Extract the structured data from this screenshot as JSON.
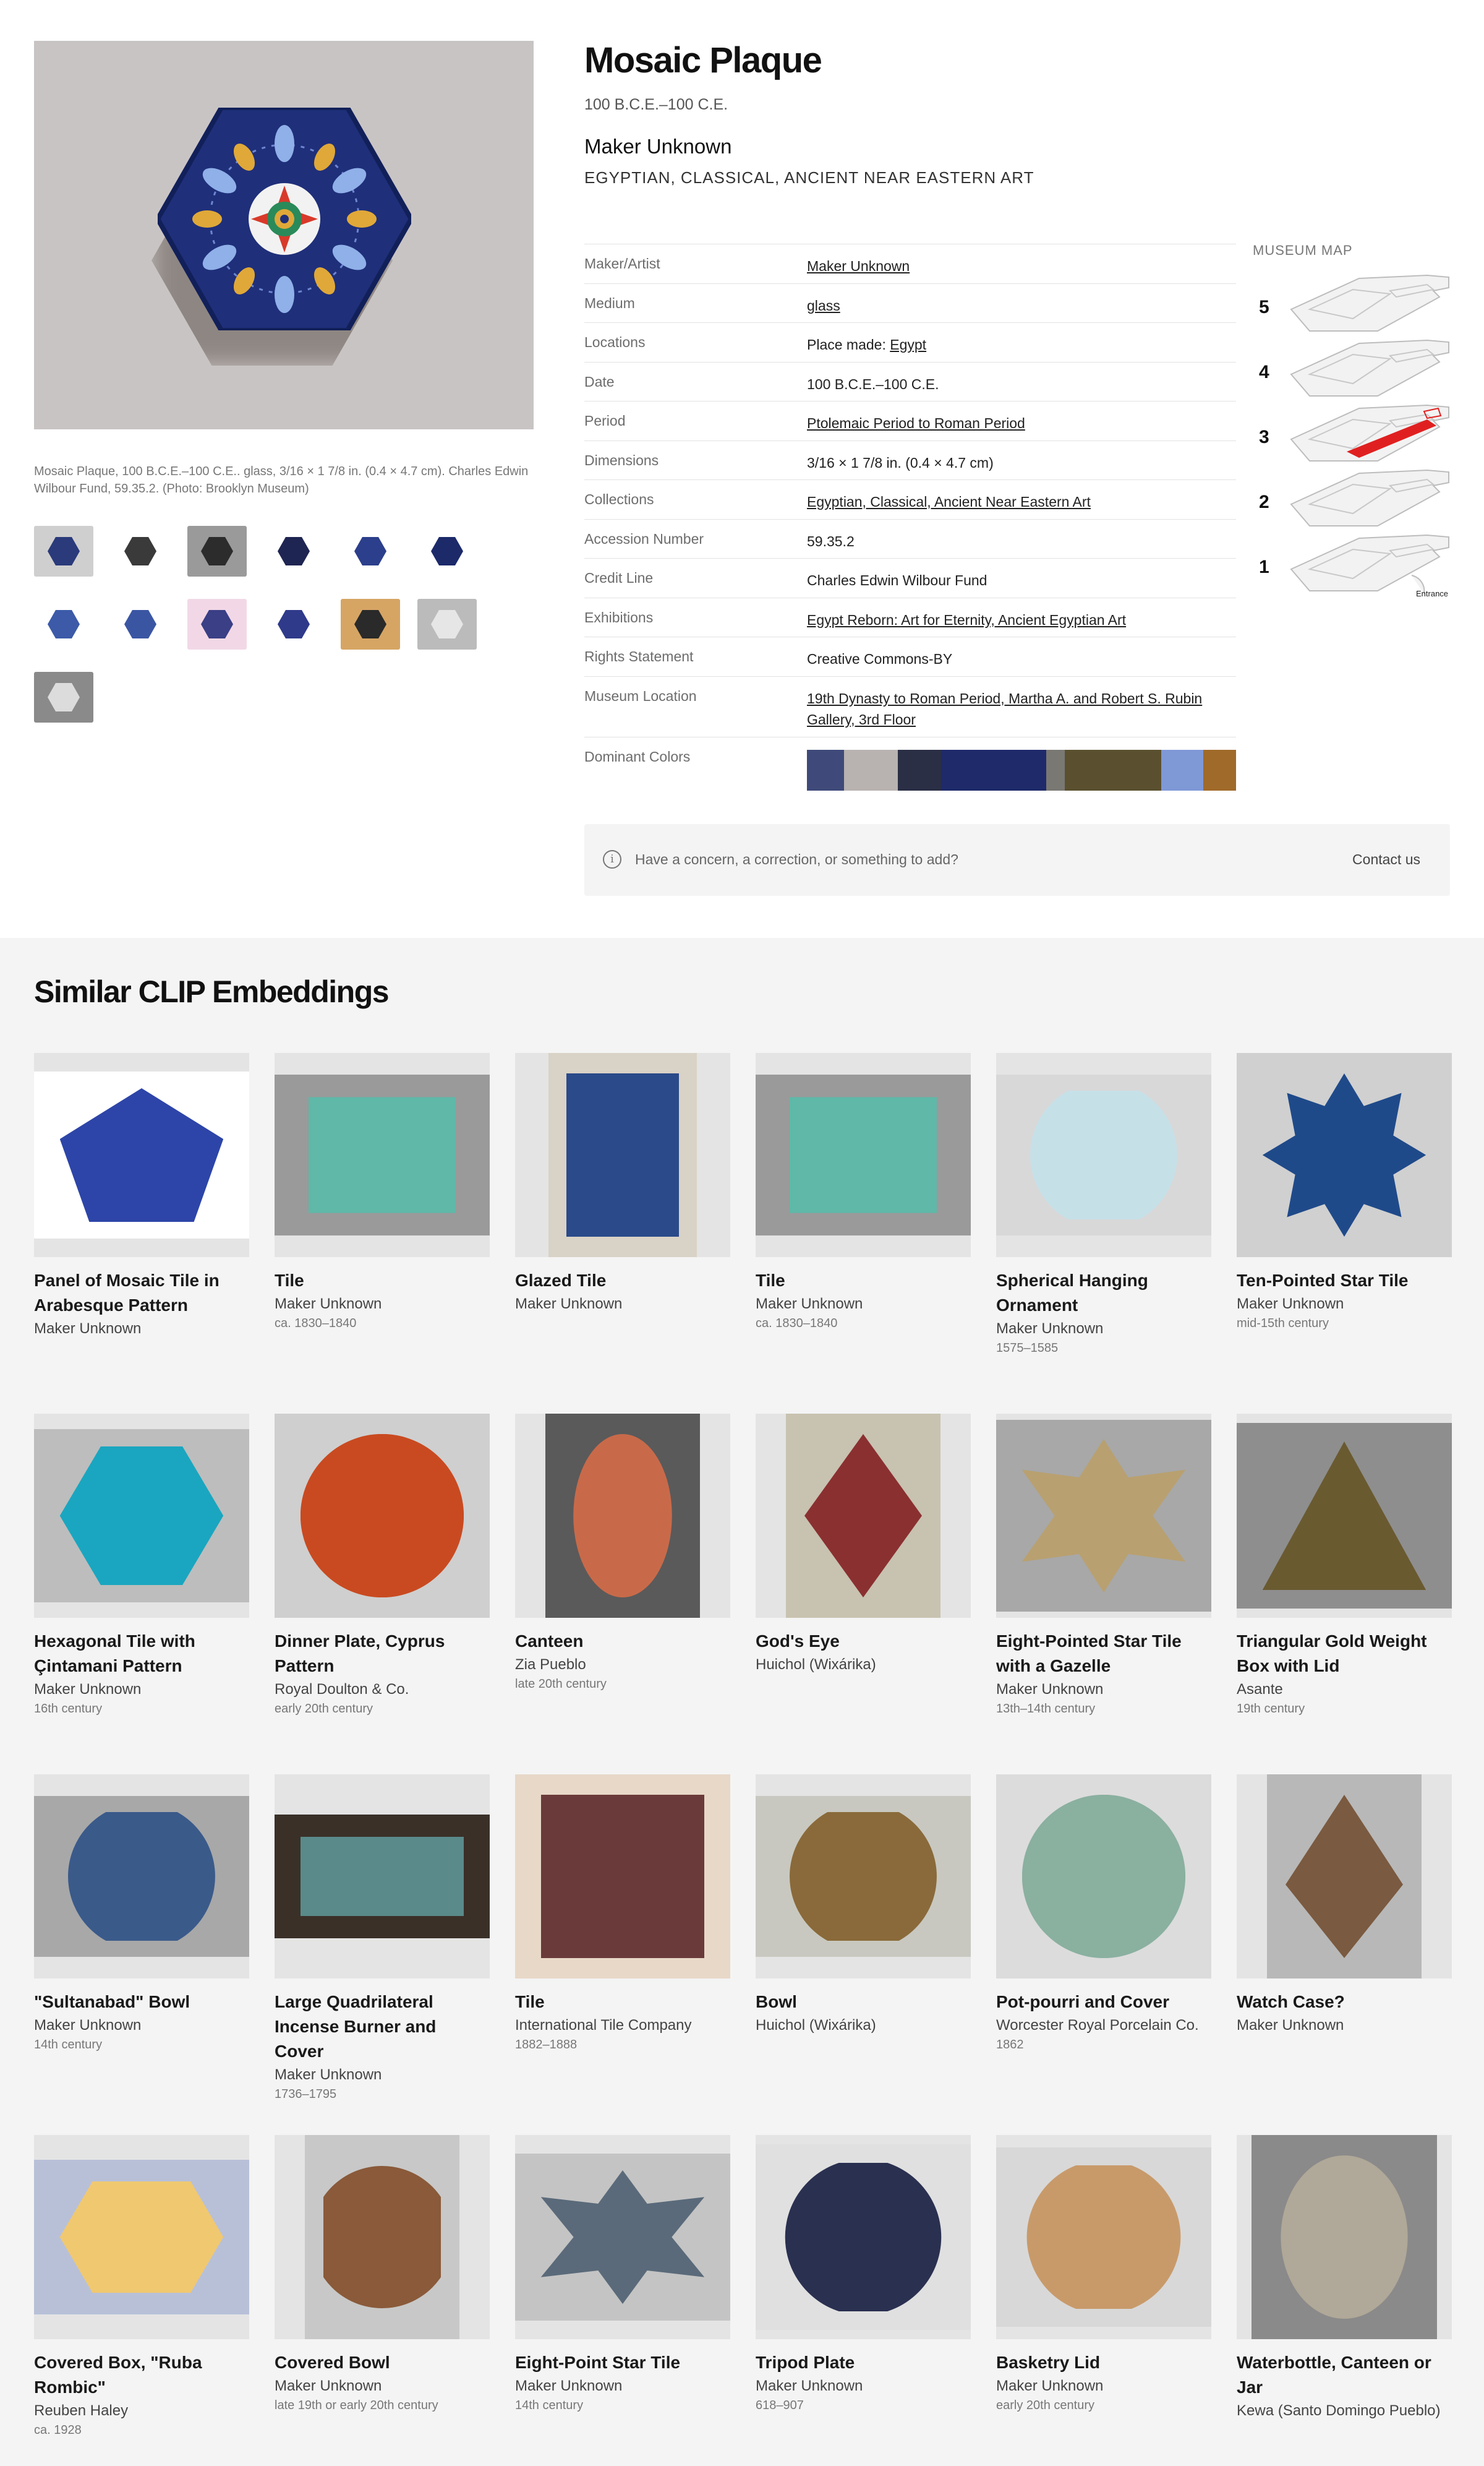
{
  "object": {
    "title": "Mosaic Plaque",
    "date": "100 B.C.E.–100 C.E.",
    "maker": "Maker Unknown",
    "department": "EGYPTIAN, CLASSICAL, ANCIENT NEAR EASTERN ART",
    "caption": "Mosaic Plaque, 100 B.C.E.–100 C.E.. glass, 3/16 × 1 7/8 in. (0.4 × 4.7 cm). Charles Edwin Wilbour Fund, 59.35.2. (Photo: Brooklyn Museum)"
  },
  "thumbnails": [
    {
      "bg": "#cfcfcf",
      "tile": "#2b3a7a"
    },
    {
      "bg": "#ffffff",
      "tile": "#3a3a3a"
    },
    {
      "bg": "#9a9a9a",
      "tile": "#2c2c2c"
    },
    {
      "bg": "#ffffff",
      "tile": "#1f2552"
    },
    {
      "bg": "#ffffff",
      "tile": "#2c3f8c"
    },
    {
      "bg": "#ffffff",
      "tile": "#1c2a6a"
    },
    {
      "bg": "#ffffff",
      "tile": "#3c5aa8"
    },
    {
      "bg": "#ffffff",
      "tile": "#3a56a3"
    },
    {
      "bg": "#f2d8e6",
      "tile": "#3a3f86"
    },
    {
      "bg": "#ffffff",
      "tile": "#2f3a8a"
    },
    {
      "bg": "#d6a564",
      "tile": "#2a2a2a"
    },
    {
      "bg": "#bbbbbb",
      "tile": "#e6e6e6"
    },
    {
      "bg": "#8a8a8a",
      "tile": "#dcdcdc"
    }
  ],
  "details": [
    {
      "label": "Maker/Artist",
      "value": "Maker Unknown",
      "link": true
    },
    {
      "label": "Medium",
      "value": "glass",
      "link": true
    },
    {
      "label": "Locations",
      "prefix": "Place made: ",
      "value": "Egypt",
      "link": true
    },
    {
      "label": "Date",
      "value": "100 B.C.E.–100 C.E.",
      "link": false
    },
    {
      "label": "Period",
      "value": "Ptolemaic Period to Roman Period",
      "link": true
    },
    {
      "label": "Dimensions",
      "value": "3/16 × 1 7/8 in. (0.4 × 4.7 cm)",
      "link": false
    },
    {
      "label": "Collections",
      "value": "Egyptian, Classical, Ancient Near Eastern Art",
      "link": true
    },
    {
      "label": "Accession Number",
      "value": "59.35.2",
      "link": false
    },
    {
      "label": "Credit Line",
      "value": "Charles Edwin Wilbour Fund",
      "link": false
    },
    {
      "label": "Exhibitions",
      "value": "Egypt Reborn: Art for Eternity, Ancient Egyptian Art",
      "link": true
    },
    {
      "label": "Rights Statement",
      "value": "Creative Commons-BY",
      "link": false
    },
    {
      "label": "Museum Location",
      "value": "19th Dynasty to Roman Period, Martha A. and Robert S. Rubin Gallery, 3rd Floor",
      "link": true
    }
  ],
  "dominant_colors_label": "Dominant Colors",
  "dominant_colors": [
    {
      "color": "#3f4a7a",
      "share": 0.088
    },
    {
      "color": "#b8b2b0",
      "share": 0.128
    },
    {
      "color": "#2a2f45",
      "share": 0.104
    },
    {
      "color": "#1e2a6a",
      "share": 0.25
    },
    {
      "color": "#7a7873",
      "share": 0.045
    },
    {
      "color": "#5a5030",
      "share": 0.23
    },
    {
      "color": "#7f98d6",
      "share": 0.1
    },
    {
      "color": "#a06a2a",
      "share": 0.078
    }
  ],
  "concern": {
    "text": "Have a concern, a correction, or something to add?",
    "contact": "Contact us",
    "icon": "info-icon"
  },
  "museum_map": {
    "title": "MUSEUM MAP",
    "floors": [
      "5",
      "4",
      "3",
      "2",
      "1"
    ],
    "highlighted_floor": "3",
    "entrance_label": "Entrance",
    "highlight_color": "#e02020"
  },
  "similar": {
    "title": "Similar CLIP Embeddings",
    "items": [
      {
        "name": "Panel of Mosaic Tile in Arabesque Pattern",
        "maker": "Maker Unknown",
        "date": "",
        "color": "#2d45a8",
        "bg": "#ffffff"
      },
      {
        "name": "Tile",
        "maker": "Maker Unknown",
        "date": "ca. 1830–1840",
        "color": "#5fb8a8",
        "bg": "#9a9a9a"
      },
      {
        "name": "Glazed Tile",
        "maker": "Maker Unknown",
        "date": "",
        "color": "#2a4a8a",
        "bg": "#d9d2c6"
      },
      {
        "name": "Tile",
        "maker": "Maker Unknown",
        "date": "ca. 1830–1840",
        "color": "#5fb8a8",
        "bg": "#9a9a9a"
      },
      {
        "name": "Spherical Hanging Ornament",
        "maker": "Maker Unknown",
        "date": "1575–1585",
        "color": "#c6e0e8",
        "bg": "#d8d8d8"
      },
      {
        "name": "Ten-Pointed Star Tile",
        "maker": "Maker Unknown",
        "date": "mid-15th century",
        "color": "#1f4a8a",
        "bg": "#d0d0d0"
      },
      {
        "name": "Hexagonal Tile with Çintamani Pattern",
        "maker": "Maker Unknown",
        "date": "16th century",
        "color": "#1aa6c0",
        "bg": "#bdbdbd"
      },
      {
        "name": "Dinner Plate, Cyprus Pattern",
        "maker": "Royal Doulton & Co.",
        "date": "early 20th century",
        "color": "#c94a20",
        "bg": "#cfcfcf"
      },
      {
        "name": "Canteen",
        "maker": "Zia Pueblo",
        "date": "late 20th century",
        "color": "#c86a4a",
        "bg": "#5a5a5a"
      },
      {
        "name": "God's Eye",
        "maker": "Huichol (Wixárika)",
        "date": "",
        "color": "#8a3030",
        "bg": "#c8c2b0"
      },
      {
        "name": "Eight-Pointed Star Tile with a Gazelle",
        "maker": "Maker Unknown",
        "date": "13th–14th century",
        "color": "#b8a070",
        "bg": "#a8a8a8"
      },
      {
        "name": "Triangular Gold Weight Box with Lid",
        "maker": "Asante",
        "date": "19th century",
        "color": "#6a5a30",
        "bg": "#8e8e8e"
      },
      {
        "name": "\"Sultanabad\" Bowl",
        "maker": "Maker Unknown",
        "date": "14th century",
        "color": "#3a5a8a",
        "bg": "#a8a8a8"
      },
      {
        "name": "Large Quadrilateral Incense Burner and Cover",
        "maker": "Maker Unknown",
        "date": "1736–1795",
        "color": "#5a8a8a",
        "bg": "#3a3028"
      },
      {
        "name": "Tile",
        "maker": "International Tile Company",
        "date": "1882–1888",
        "color": "#6a3a3a",
        "bg": "#e8d8c8"
      },
      {
        "name": "Bowl",
        "maker": "Huichol (Wixárika)",
        "date": "",
        "color": "#8a6a3a",
        "bg": "#c8c8c0"
      },
      {
        "name": "Pot-pourri and Cover",
        "maker": "Worcester Royal Porcelain Co.",
        "date": "1862",
        "color": "#8ab0a0",
        "bg": "#dcdcdc"
      },
      {
        "name": "Watch Case?",
        "maker": "Maker Unknown",
        "date": "",
        "color": "#7a5a40",
        "bg": "#b8b8b8"
      },
      {
        "name": "Covered Box, \"Ruba Rombic\"",
        "maker": "Reuben Haley",
        "date": "ca. 1928",
        "color": "#f0c870",
        "bg": "#b8c0d8"
      },
      {
        "name": "Covered Bowl",
        "maker": "Maker Unknown",
        "date": "late 19th or early 20th century",
        "color": "#8a5a3a",
        "bg": "#c8c8c8"
      },
      {
        "name": "Eight-Point Star Tile",
        "maker": "Maker Unknown",
        "date": "14th century",
        "color": "#5a6a7a",
        "bg": "#c4c4c4"
      },
      {
        "name": "Tripod Plate",
        "maker": "Maker Unknown",
        "date": "618–907",
        "color": "#2a3050",
        "bg": "#e0e0e0"
      },
      {
        "name": "Basketry Lid",
        "maker": "Maker Unknown",
        "date": "early 20th century",
        "color": "#c89a6a",
        "bg": "#d8d8d8"
      },
      {
        "name": "Waterbottle, Canteen or Jar",
        "maker": "Kewa (Santo Domingo Pueblo)",
        "date": "",
        "color": "#b0a898",
        "bg": "#8a8a8a"
      }
    ]
  }
}
